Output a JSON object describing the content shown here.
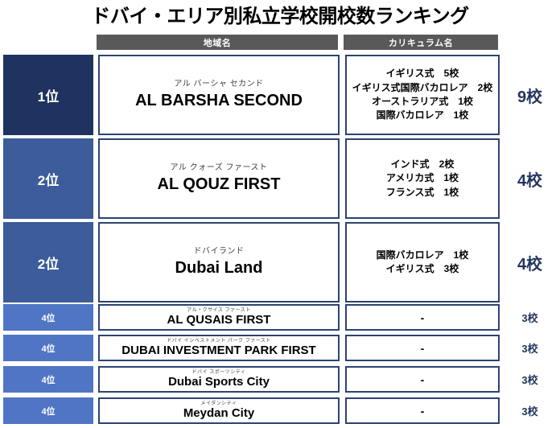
{
  "page": {
    "title": "ドバイ・エリア別私立学校開校数ランキング"
  },
  "colors": {
    "rank_1_bg": "#1f3360",
    "rank_2_bg": "#3c5c9b",
    "rank_4_bg": "#4f75c4",
    "header_bg": "#595959",
    "cell_border": "#2c4372",
    "total_text": "#24365f"
  },
  "headers": {
    "area": "地域名",
    "curriculum": "カリキュラム名"
  },
  "rows": [
    {
      "rank": "1位",
      "ruby": "アル バーシャ セカンド",
      "area": "AL BARSHA SECOND",
      "curriculum": [
        "イギリス式　5校",
        "イギリス式国際バカロレア　2校",
        "オーストラリア式　1校",
        "国際バカロレア　1校"
      ],
      "total": "9校"
    },
    {
      "rank": "2位",
      "ruby": "アル クォーズ ファースト",
      "area": "AL QOUZ FIRST",
      "curriculum": [
        "インド式　2校",
        "アメリカ式　1校",
        "フランス式　1校"
      ],
      "total": "4校"
    },
    {
      "rank": "2位",
      "ruby": "ドバイランド",
      "area": "Dubai Land",
      "curriculum": [
        "国際バカロレア　1校",
        "イギリス式　3校"
      ],
      "total": "4校"
    },
    {
      "rank": "4位",
      "ruby": "アル・クサイス ファースト",
      "area": "AL QUSAIS FIRST",
      "curriculum": [
        "-"
      ],
      "total": "3校"
    },
    {
      "rank": "4位",
      "ruby": "ドバイ インベストメント パーク ファースト",
      "area": "DUBAI INVESTMENT PARK FIRST",
      "curriculum": [
        "-"
      ],
      "total": "3校"
    },
    {
      "rank": "4位",
      "ruby": "ドバイ スポーツシティ",
      "area": "Dubai Sports City",
      "curriculum": [
        "-"
      ],
      "total": "3校"
    },
    {
      "rank": "4位",
      "ruby": "メイダンシティ",
      "area": "Meydan City",
      "curriculum": [
        "-"
      ],
      "total": "3校"
    }
  ]
}
